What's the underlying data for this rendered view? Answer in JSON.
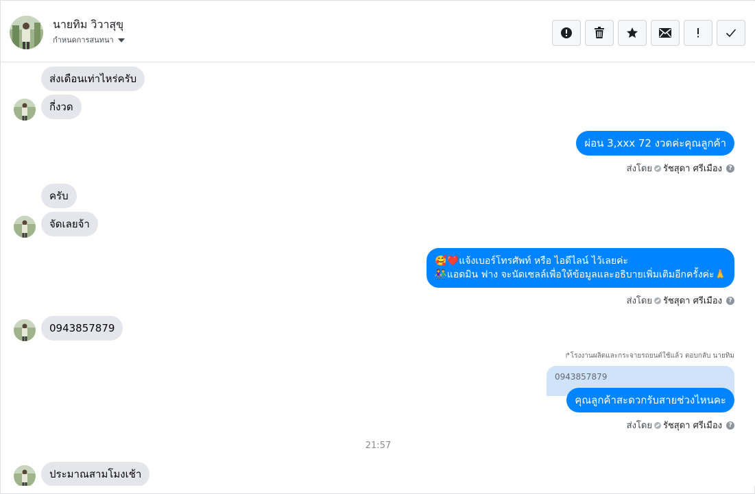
{
  "header": {
    "contact_name": "นายทิม วิวาสุขุ",
    "subtitle": "กำหนดการสนทนา",
    "actions": [
      {
        "name": "spam",
        "icon": "alert-circle-icon"
      },
      {
        "name": "delete",
        "icon": "trash-icon"
      },
      {
        "name": "star",
        "icon": "star-icon"
      },
      {
        "name": "mark-unread",
        "icon": "envelope-icon"
      },
      {
        "name": "important",
        "icon": "exclamation-icon"
      },
      {
        "name": "done",
        "icon": "check-icon"
      }
    ]
  },
  "messages": {
    "m1": "ส่งเดือนเท่าไหร่ครับ",
    "m2": "กี่งวด",
    "m3": "ผ่อน 3,xxx  72  งวดค่ะคุณลูกค้า",
    "m4": "ครับ",
    "m5": "จัดเลยจ้า",
    "m6_line1": "🥰❤️แจ้งเบอร์โทรศัพท์ หรือ ไอดีไลน์  ไว้เลยค่ะ",
    "m6_line2": "👫แอดมิน ฟาง จะนัดเซลล์เพื่อให้ข้อมูลและอธิบายเพิ่มเติมอีกครั้งค่ะ🙏",
    "m7": "0943857879",
    "reply_note": "↱โรงงานผลิตและกระจายรถยนต์ใช้แล้ว ตอบกลับ นายทิม",
    "quoted": "0943857879",
    "m8": "คุณลูกค้าสะดวกรับสายช่วงไหนคะ",
    "time": "21:57",
    "m9": "ประมาณสามโมงเช้า"
  },
  "sent_by": {
    "label": "ส่งโดย",
    "name": "รัชสุดา ศรีเมือง",
    "help": "?"
  },
  "colors": {
    "outgoing": "#0084ff",
    "incoming": "#e4e6eb",
    "quoted": "#cfe3fb"
  }
}
